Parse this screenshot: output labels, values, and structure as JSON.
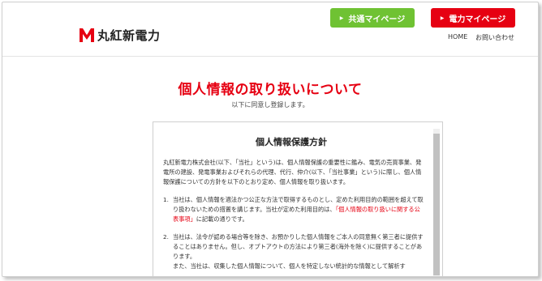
{
  "header": {
    "logo_text": "丸紅新電力",
    "btn_common": "共通マイページ",
    "btn_power": "電力マイページ",
    "nav_home": "HOME",
    "nav_contact": "お問い合わせ"
  },
  "main": {
    "title": "個人情報の取り扱いについて",
    "subtitle": "以下に同意し登録します。"
  },
  "policy": {
    "heading": "個人情報保護方針",
    "intro": "丸紅新電力株式会社(以下、「当社」という)は、個人情報保護の重要性に鑑み、電気の売買事業、発電所の建設、発電事業およびそれらの代理、代行、仲介(以下、「当社事業」という)に際し、個人情報保護についての方針を以下のとおり定め、個人情報を取り扱います。",
    "item1_num": "1.",
    "item1_text": "当社は、個人情報を適法かつ公正な方法で取得するものとし、定めた利用目的の範囲を超えて取り扱わないための措置を講じます。当社が定めた利用目的は、",
    "item1_link": "「個人情報の取り扱いに関する公表事項」",
    "item1_tail": "に記載の通りです。",
    "item2_num": "2.",
    "item2_text": "当社は、法令が認める場合等を除き、お預かりした個人情報をご本人の同意無く第三者に提供することはありません。但し、オプトアウトの方法により第三者(海外を除く)に提供することがあります。",
    "item2_more": "また、当社は、収集した個人情報について、個人を特定しない統計的な情報として解析す"
  },
  "colors": {
    "brand_red": "#e60012",
    "green": "#6fc233"
  }
}
